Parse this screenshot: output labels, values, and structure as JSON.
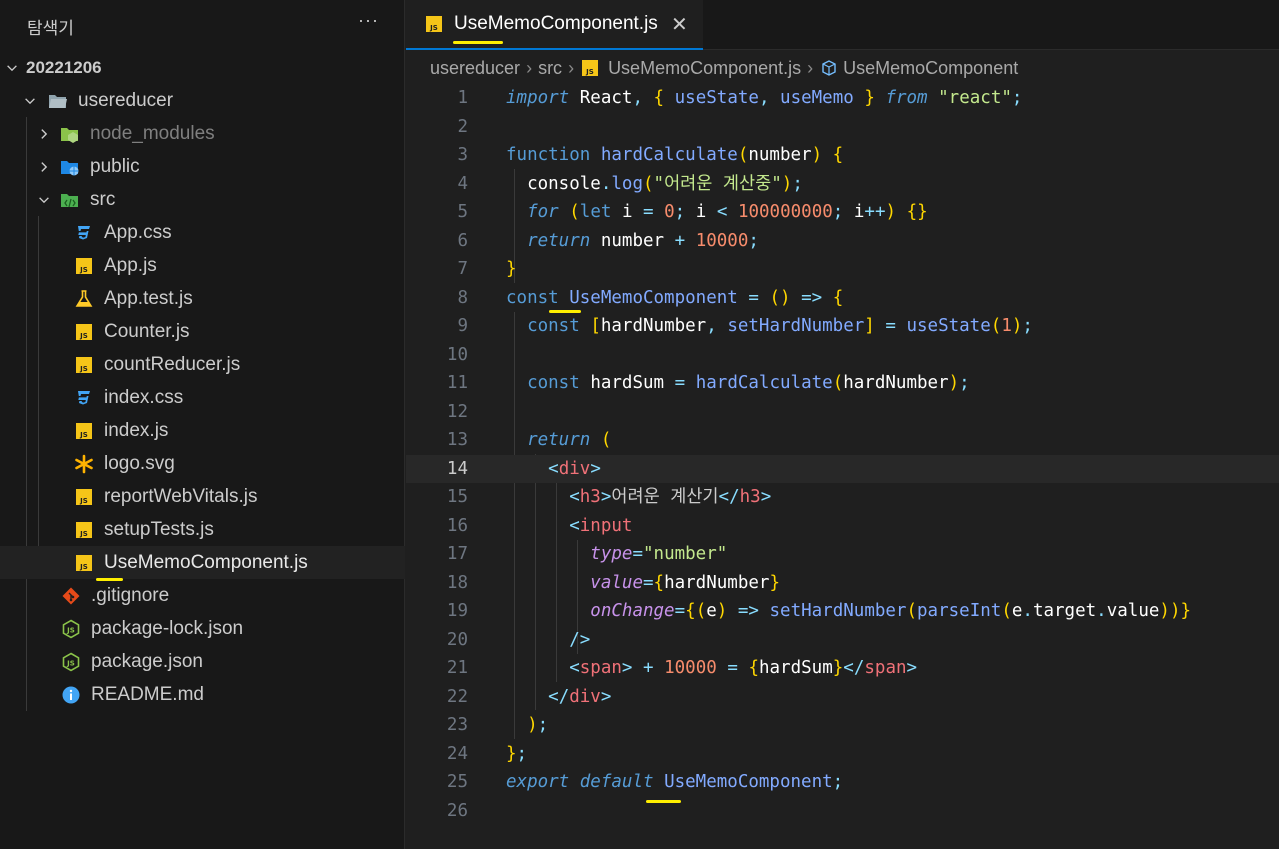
{
  "explorer": {
    "title": "탐색기",
    "more": "···",
    "root": "20221206",
    "project": "usereducer",
    "folders": [
      "node_modules",
      "public",
      "src"
    ],
    "src_files": [
      "App.css",
      "App.js",
      "App.test.js",
      "Counter.js",
      "countReducer.js",
      "index.css",
      "index.js",
      "logo.svg",
      "reportWebVitals.js",
      "setupTests.js",
      "UseMemoComponent.js"
    ],
    "project_files": [
      ".gitignore",
      "package-lock.json",
      "package.json",
      "README.md"
    ]
  },
  "tab": {
    "label": "UseMemoComponent.js",
    "close": "✕"
  },
  "breadcrumb": [
    "usereducer",
    "src",
    "UseMemoComponent.js",
    "UseMemoComponent"
  ],
  "code_lines": [
    "import React, { useState, useMemo } from \"react\";",
    "",
    "function hardCalculate(number) {",
    "  console.log(\"어려운 계산중\");",
    "  for (let i = 0; i < 100000000; i++) {}",
    "  return number + 10000;",
    "}",
    "const UseMemoComponent = () => {",
    "  const [hardNumber, setHardNumber] = useState(1);",
    "",
    "  const hardSum = hardCalculate(hardNumber);",
    "",
    "  return (",
    "    <div>",
    "      <h3>어려운 계산기</h3>",
    "      <input",
    "        type=\"number\"",
    "        value={hardNumber}",
    "        onChange={(e) => setHardNumber(parseInt(e.target.value))}",
    "      />",
    "      <span> + 10000 = {hardSum}</span>",
    "    </div>",
    "  );",
    "};",
    "export default UseMemoComponent;",
    ""
  ],
  "current_line": 14,
  "colors": {
    "sidebar_bg": "#181818",
    "editor_bg": "#1f1f1f",
    "highlight_marker": "#ffef00",
    "active_tab_border": "#0078d4"
  }
}
